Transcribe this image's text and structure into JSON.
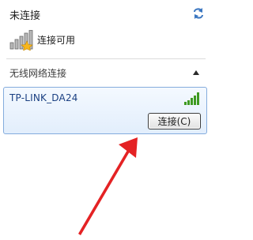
{
  "status": {
    "title": "未连接",
    "refresh_icon": "refresh-icon"
  },
  "availability": {
    "text": "连接可用",
    "icon": "signal-bars-with-star-icon"
  },
  "section": {
    "title": "无线网络连接",
    "collapse_icon": "chevron-up-icon"
  },
  "network": {
    "ssid": "TP-LINK_DA24",
    "signal_icon": "wifi-signal-icon",
    "connect_label": "连接(C)"
  },
  "annotation": {
    "arrow_color": "#e42224"
  },
  "colors": {
    "card_border": "#84acdd",
    "ssid_text": "#1a3f82",
    "signal_green": "#3f9a22"
  }
}
